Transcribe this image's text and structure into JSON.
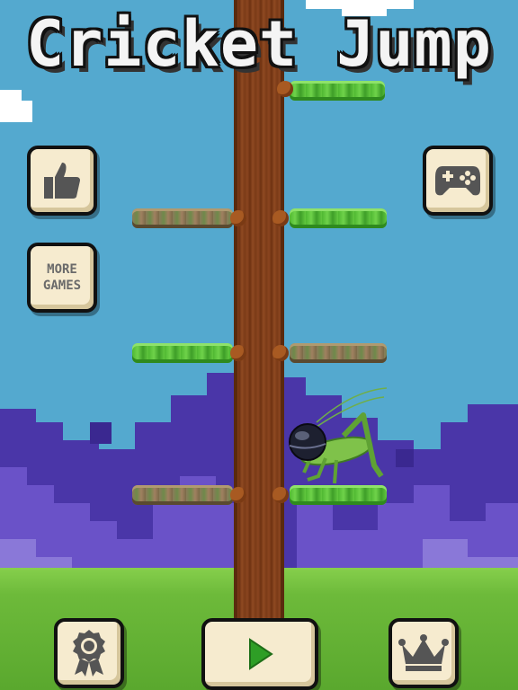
{
  "title": "Cricket Jump",
  "buttons": {
    "like_icon": "thumbs-up-icon",
    "more_games_label": "MORE\nGAMES",
    "controller_icon": "gamepad-icon",
    "achievements_icon": "award-ribbon-icon",
    "play_icon": "play-icon",
    "leaderboard_icon": "crown-icon"
  },
  "colors": {
    "sky": "#54a9cf",
    "mountain_dark": "#4a36a8",
    "mountain_mid": "#6a52c8",
    "grass": "#6dba3a",
    "trunk": "#7a3a16",
    "branch_green": "#4fb832",
    "branch_dry": "#8a7a5a",
    "button_face": "#f6ebcf",
    "play_green": "#2e9e26"
  }
}
